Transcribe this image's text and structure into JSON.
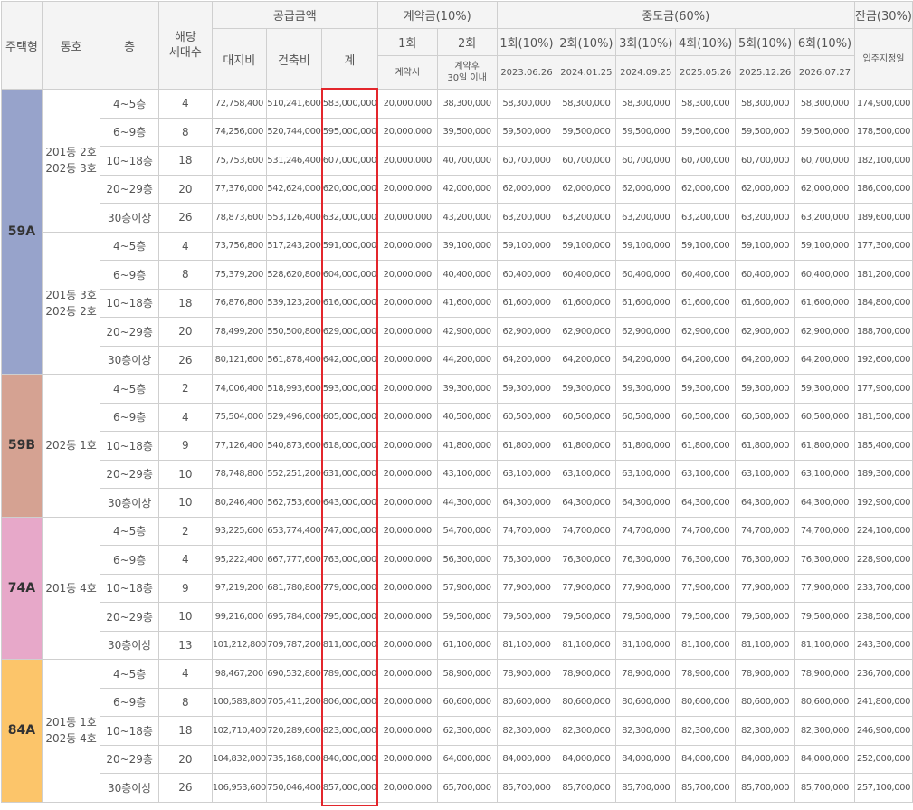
{
  "header": {
    "type": "주택형",
    "dong": "동호",
    "floor": "층",
    "units": "해당 세대수",
    "supply": "공급금액",
    "land": "대지비",
    "building": "건축비",
    "total": "계",
    "deposit": "계약금(10%)",
    "dep1": "1회",
    "dep2": "2회",
    "dep1_note": "계약시",
    "dep2_note_line1": "계약후",
    "dep2_note_line2": "30일 이내",
    "middle": "중도금(60%)",
    "mid_labels": [
      "1회(10%)",
      "2회(10%)",
      "3회(10%)",
      "4회(10%)",
      "5회(10%)",
      "6회(10%)"
    ],
    "mid_dates": [
      "2023.06.26",
      "2024.01.25",
      "2024.09.25",
      "2025.05.26",
      "2025.12.26",
      "2026.07.27"
    ],
    "balance": "잔금(30%)",
    "balance_note": "입주지정일"
  },
  "groups": [
    {
      "type": "59A",
      "color": "#97a3cb",
      "sections": [
        {
          "dong": "201동 2호\n202동 3호",
          "rows": [
            {
              "floor": "4~5층",
              "units": "4",
              "land": "72,758,400",
              "building": "510,241,600",
              "total": "583,000,000",
              "d1": "20,000,000",
              "d2": "38,300,000",
              "mid": "58,300,000",
              "bal": "174,900,000"
            },
            {
              "floor": "6~9층",
              "units": "8",
              "land": "74,256,000",
              "building": "520,744,000",
              "total": "595,000,000",
              "d1": "20,000,000",
              "d2": "39,500,000",
              "mid": "59,500,000",
              "bal": "178,500,000"
            },
            {
              "floor": "10~18층",
              "units": "18",
              "land": "75,753,600",
              "building": "531,246,400",
              "total": "607,000,000",
              "d1": "20,000,000",
              "d2": "40,700,000",
              "mid": "60,700,000",
              "bal": "182,100,000"
            },
            {
              "floor": "20~29층",
              "units": "20",
              "land": "77,376,000",
              "building": "542,624,000",
              "total": "620,000,000",
              "d1": "20,000,000",
              "d2": "42,000,000",
              "mid": "62,000,000",
              "bal": "186,000,000"
            },
            {
              "floor": "30층이상",
              "units": "26",
              "land": "78,873,600",
              "building": "553,126,400",
              "total": "632,000,000",
              "d1": "20,000,000",
              "d2": "43,200,000",
              "mid": "63,200,000",
              "bal": "189,600,000"
            }
          ]
        },
        {
          "dong": "201동 3호\n202동 2호",
          "rows": [
            {
              "floor": "4~5층",
              "units": "4",
              "land": "73,756,800",
              "building": "517,243,200",
              "total": "591,000,000",
              "d1": "20,000,000",
              "d2": "39,100,000",
              "mid": "59,100,000",
              "bal": "177,300,000"
            },
            {
              "floor": "6~9층",
              "units": "8",
              "land": "75,379,200",
              "building": "528,620,800",
              "total": "604,000,000",
              "d1": "20,000,000",
              "d2": "40,400,000",
              "mid": "60,400,000",
              "bal": "181,200,000"
            },
            {
              "floor": "10~18층",
              "units": "18",
              "land": "76,876,800",
              "building": "539,123,200",
              "total": "616,000,000",
              "d1": "20,000,000",
              "d2": "41,600,000",
              "mid": "61,600,000",
              "bal": "184,800,000"
            },
            {
              "floor": "20~29층",
              "units": "20",
              "land": "78,499,200",
              "building": "550,500,800",
              "total": "629,000,000",
              "d1": "20,000,000",
              "d2": "42,900,000",
              "mid": "62,900,000",
              "bal": "188,700,000"
            },
            {
              "floor": "30층이상",
              "units": "26",
              "land": "80,121,600",
              "building": "561,878,400",
              "total": "642,000,000",
              "d1": "20,000,000",
              "d2": "44,200,000",
              "mid": "64,200,000",
              "bal": "192,600,000"
            }
          ]
        }
      ]
    },
    {
      "type": "59B",
      "color": "#d5a292",
      "sections": [
        {
          "dong": "202동 1호",
          "rows": [
            {
              "floor": "4~5층",
              "units": "2",
              "land": "74,006,400",
              "building": "518,993,600",
              "total": "593,000,000",
              "d1": "20,000,000",
              "d2": "39,300,000",
              "mid": "59,300,000",
              "bal": "177,900,000"
            },
            {
              "floor": "6~9층",
              "units": "4",
              "land": "75,504,000",
              "building": "529,496,000",
              "total": "605,000,000",
              "d1": "20,000,000",
              "d2": "40,500,000",
              "mid": "60,500,000",
              "bal": "181,500,000"
            },
            {
              "floor": "10~18층",
              "units": "9",
              "land": "77,126,400",
              "building": "540,873,600",
              "total": "618,000,000",
              "d1": "20,000,000",
              "d2": "41,800,000",
              "mid": "61,800,000",
              "bal": "185,400,000"
            },
            {
              "floor": "20~29층",
              "units": "10",
              "land": "78,748,800",
              "building": "552,251,200",
              "total": "631,000,000",
              "d1": "20,000,000",
              "d2": "43,100,000",
              "mid": "63,100,000",
              "bal": "189,300,000"
            },
            {
              "floor": "30층이상",
              "units": "10",
              "land": "80,246,400",
              "building": "562,753,600",
              "total": "643,000,000",
              "d1": "20,000,000",
              "d2": "44,300,000",
              "mid": "64,300,000",
              "bal": "192,900,000"
            }
          ]
        }
      ]
    },
    {
      "type": "74A",
      "color": "#e7a8c9",
      "sections": [
        {
          "dong": "201동 4호",
          "rows": [
            {
              "floor": "4~5층",
              "units": "2",
              "land": "93,225,600",
              "building": "653,774,400",
              "total": "747,000,000",
              "d1": "20,000,000",
              "d2": "54,700,000",
              "mid": "74,700,000",
              "bal": "224,100,000"
            },
            {
              "floor": "6~9층",
              "units": "4",
              "land": "95,222,400",
              "building": "667,777,600",
              "total": "763,000,000",
              "d1": "20,000,000",
              "d2": "56,300,000",
              "mid": "76,300,000",
              "bal": "228,900,000"
            },
            {
              "floor": "10~18층",
              "units": "9",
              "land": "97,219,200",
              "building": "681,780,800",
              "total": "779,000,000",
              "d1": "20,000,000",
              "d2": "57,900,000",
              "mid": "77,900,000",
              "bal": "233,700,000"
            },
            {
              "floor": "20~29층",
              "units": "10",
              "land": "99,216,000",
              "building": "695,784,000",
              "total": "795,000,000",
              "d1": "20,000,000",
              "d2": "59,500,000",
              "mid": "79,500,000",
              "bal": "238,500,000"
            },
            {
              "floor": "30층이상",
              "units": "13",
              "land": "101,212,800",
              "building": "709,787,200",
              "total": "811,000,000",
              "d1": "20,000,000",
              "d2": "61,100,000",
              "mid": "81,100,000",
              "bal": "243,300,000"
            }
          ]
        }
      ]
    },
    {
      "type": "84A",
      "color": "#fcc56a",
      "sections": [
        {
          "dong": "201동 1호\n202동 4호",
          "rows": [
            {
              "floor": "4~5층",
              "units": "4",
              "land": "98,467,200",
              "building": "690,532,800",
              "total": "789,000,000",
              "d1": "20,000,000",
              "d2": "58,900,000",
              "mid": "78,900,000",
              "bal": "236,700,000"
            },
            {
              "floor": "6~9층",
              "units": "8",
              "land": "100,588,800",
              "building": "705,411,200",
              "total": "806,000,000",
              "d1": "20,000,000",
              "d2": "60,600,000",
              "mid": "80,600,000",
              "bal": "241,800,000"
            },
            {
              "floor": "10~18층",
              "units": "18",
              "land": "102,710,400",
              "building": "720,289,600",
              "total": "823,000,000",
              "d1": "20,000,000",
              "d2": "62,300,000",
              "mid": "82,300,000",
              "bal": "246,900,000"
            },
            {
              "floor": "20~29층",
              "units": "20",
              "land": "104,832,000",
              "building": "735,168,000",
              "total": "840,000,000",
              "d1": "20,000,000",
              "d2": "64,000,000",
              "mid": "84,000,000",
              "bal": "252,000,000"
            },
            {
              "floor": "30층이상",
              "units": "26",
              "land": "106,953,600",
              "building": "750,046,400",
              "total": "857,000,000",
              "d1": "20,000,000",
              "d2": "65,700,000",
              "mid": "85,700,000",
              "bal": "257,100,000"
            }
          ]
        }
      ]
    }
  ]
}
